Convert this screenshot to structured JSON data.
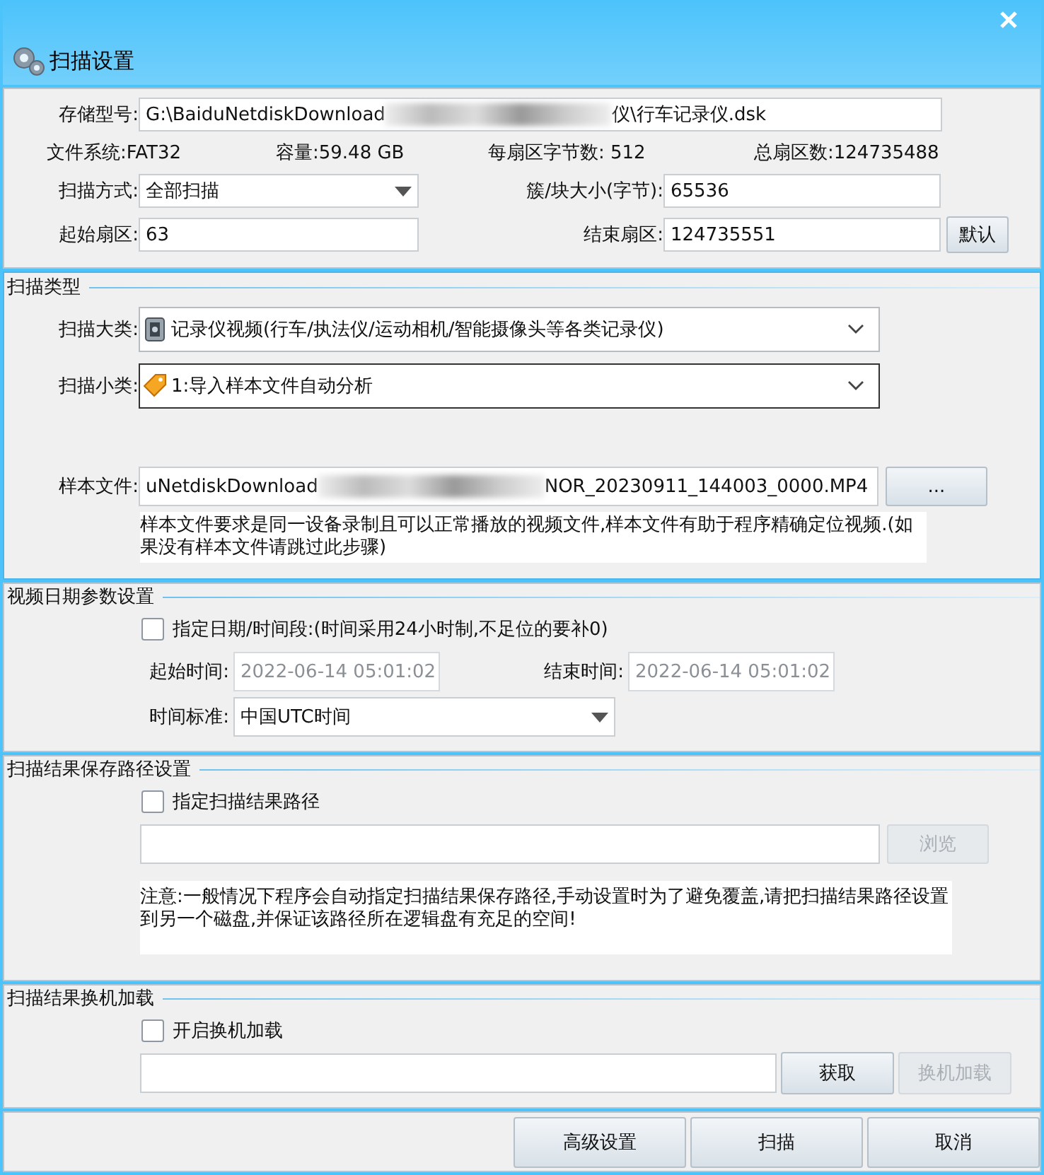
{
  "window": {
    "title": "扫描设置"
  },
  "device": {
    "storage": {
      "label": "存储型号:",
      "value_parts": [
        "G:\\BaiduNetdiskDownload",
        "仪\\行车记录仪.dsk"
      ]
    },
    "info": [
      "文件系统:FAT32",
      "容量:59.48 GB",
      "每扇区字节数: 512",
      "总扇区数:124735488"
    ],
    "scan_mode": {
      "label": "扫描方式:",
      "value": "全部扫描"
    },
    "cluster_size": {
      "label": "簇/块大小(字节):",
      "value": "65536"
    },
    "start_sector": {
      "label": "起始扇区:",
      "value": "63"
    },
    "end_sector": {
      "label": "结束扇区:",
      "value": "124735551"
    },
    "default_button": "默认"
  },
  "scan_type": {
    "title": "扫描类型",
    "focused": true,
    "major": {
      "label": "扫描大类:",
      "value": "记录仪视频(行车/执法仪/运动相机/智能摄像头等各类记录仪)",
      "focused": false
    },
    "minor": {
      "label": "扫描小类:",
      "value": "1:导入样本文件自动分析",
      "focused": true
    },
    "sample_file": {
      "label": "样本文件:",
      "value_parts": [
        "uNetdiskDownload",
        "NOR_20230911_144003_0000.MP4"
      ]
    },
    "browse_button": "...",
    "note": "样本文件要求是同一设备录制且可以正常播放的视频文件,样本文件有助于程序精确定位视频.(如果没有样本文件请跳过此步骤)"
  },
  "video_date": {
    "title": "视频日期参数设置",
    "focused": false,
    "checkbox": {
      "label": "指定日期/时间段:(时间采用24小时制,不足位的要补0)",
      "checked": false
    },
    "start_time": {
      "label": "起始时间:",
      "value": "2022-06-14 05:01:02",
      "disabled": true
    },
    "end_time": {
      "label": "结束时间:",
      "value": "2022-06-14 05:01:02",
      "disabled": true
    },
    "time_standard": {
      "label": "时间标准:",
      "value": "中国UTC时间"
    }
  },
  "result_path": {
    "title": "扫描结果保存路径设置",
    "focused": false,
    "checkbox": {
      "label": "指定扫描结果路径",
      "checked": false
    },
    "browse_button": {
      "label": "浏览",
      "disabled": true
    },
    "note": "注意:一般情况下程序会自动指定扫描结果保存路径,手动设置时为了避免覆盖,请把扫描结果路径设置到另一个磁盘,并保证该路径所在逻辑盘有充足的空间!"
  },
  "remote_load": {
    "title": "扫描结果换机加载",
    "focused": false,
    "checkbox": {
      "label": "开启换机加载",
      "checked": false
    },
    "get_button": {
      "label": "获取",
      "disabled": false
    },
    "load_button": {
      "label": "换机加载",
      "disabled": true
    }
  },
  "footer_buttons": [
    "高级设置",
    "扫描",
    "取消"
  ]
}
